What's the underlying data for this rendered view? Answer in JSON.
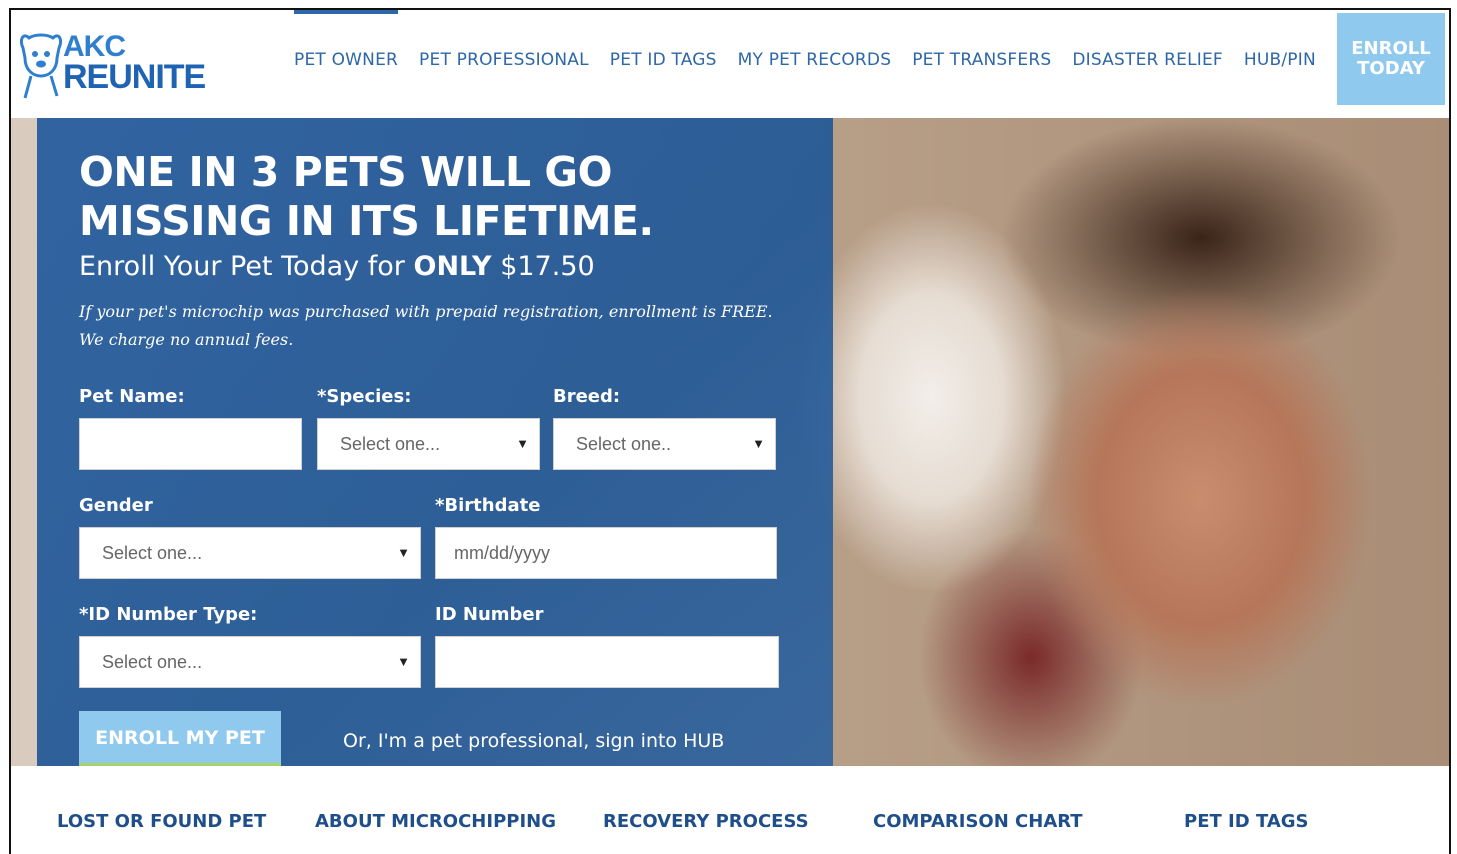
{
  "brand": {
    "line1": "AKC",
    "line2": "REUNITE"
  },
  "nav": {
    "items": [
      {
        "label": "PET OWNER"
      },
      {
        "label": "PET PROFESSIONAL"
      },
      {
        "label": "PET ID TAGS"
      },
      {
        "label": "MY PET RECORDS"
      },
      {
        "label": "PET TRANSFERS"
      },
      {
        "label": "DISASTER RELIEF"
      },
      {
        "label": "HUB/PIN"
      }
    ],
    "active": "PET OWNER",
    "cta_line1": "ENROLL",
    "cta_line2": "TODAY"
  },
  "hero": {
    "headline": "ONE IN 3 PETS WILL GO MISSING IN ITS LIFETIME.",
    "subhead_prefix": "Enroll Your Pet Today for",
    "subhead_bold": "ONLY",
    "subhead_price": "$17.50",
    "note_line1": "If your pet's microchip was purchased with prepaid registration, enrollment is FREE.",
    "note_line2": "We charge no annual fees."
  },
  "form": {
    "pet_name_label": "Pet Name:",
    "pet_name_value": "",
    "species_label": "*Species:",
    "species_value": "Select one...",
    "breed_label": "Breed:",
    "breed_value": "Select one..",
    "gender_label": "Gender",
    "gender_value": "Select one...",
    "birthdate_label": "*Birthdate",
    "birthdate_placeholder": "mm/dd/yyyy",
    "id_type_label": "*ID Number Type:",
    "id_type_value": "Select one...",
    "id_number_label": "ID Number",
    "id_number_value": "",
    "submit_label": "ENROLL MY PET",
    "pro_link": "Or, I'm a pet professional, sign into HUB"
  },
  "subnav": {
    "items": [
      {
        "label": "LOST OR FOUND PET"
      },
      {
        "label": "ABOUT MICROCHIPPING"
      },
      {
        "label": "RECOVERY PROCESS"
      },
      {
        "label": "COMPARISON CHART"
      },
      {
        "label": "PET ID TAGS"
      }
    ]
  },
  "colors": {
    "brand_blue": "#2d67a7",
    "panel_blue": "#245ca0",
    "cta_light_blue": "#8fc9ee",
    "accent_green": "#a8d36a"
  },
  "icons": {
    "logo": "dog-face-icon",
    "dropdown": "dropdown-arrow-icon"
  }
}
